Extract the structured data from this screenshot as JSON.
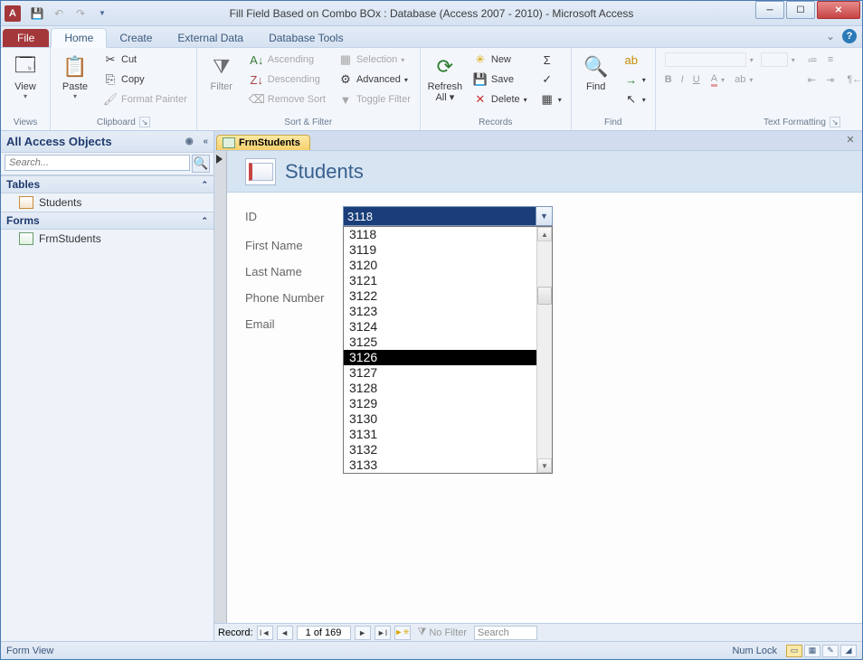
{
  "window": {
    "title": "Fill Field Based on Combo BOx : Database (Access 2007 - 2010)  -  Microsoft Access",
    "app_letter": "A"
  },
  "ribbon": {
    "file": "File",
    "tabs": {
      "home": "Home",
      "create": "Create",
      "external": "External Data",
      "tools": "Database Tools"
    },
    "views": {
      "view": "View",
      "group": "Views"
    },
    "clipboard": {
      "paste": "Paste",
      "cut": "Cut",
      "copy": "Copy",
      "painter": "Format Painter",
      "group": "Clipboard"
    },
    "sort": {
      "filter": "Filter",
      "asc": "Ascending",
      "desc": "Descending",
      "remove": "Remove Sort",
      "selection": "Selection",
      "advanced": "Advanced",
      "toggle": "Toggle Filter",
      "group": "Sort & Filter"
    },
    "records": {
      "refresh": "Refresh All",
      "new": "New",
      "save": "Save",
      "delete": "Delete",
      "totals": "Σ",
      "group": "Records"
    },
    "find": {
      "find": "Find",
      "group": "Find"
    },
    "text": {
      "group": "Text Formatting"
    }
  },
  "nav": {
    "header": "All Access Objects",
    "search_placeholder": "Search...",
    "tables_header": "Tables",
    "forms_header": "Forms",
    "items": {
      "students": "Students",
      "frmstudents": "FrmStudents"
    }
  },
  "doc": {
    "tab": "FrmStudents",
    "form_title": "Students",
    "labels": {
      "id": "ID",
      "first": "First Name",
      "last": "Last Name",
      "phone": "Phone Number",
      "email": "Email"
    },
    "combo_value": "3118",
    "combo_items": [
      "3118",
      "3119",
      "3120",
      "3121",
      "3122",
      "3123",
      "3124",
      "3125",
      "3126",
      "3127",
      "3128",
      "3129",
      "3130",
      "3131",
      "3132",
      "3133"
    ],
    "combo_selected": "3126"
  },
  "recordnav": {
    "label": "Record:",
    "counter": "1 of 169",
    "nofilter": "No Filter",
    "search": "Search"
  },
  "status": {
    "left": "Form View",
    "numlock": "Num Lock"
  }
}
